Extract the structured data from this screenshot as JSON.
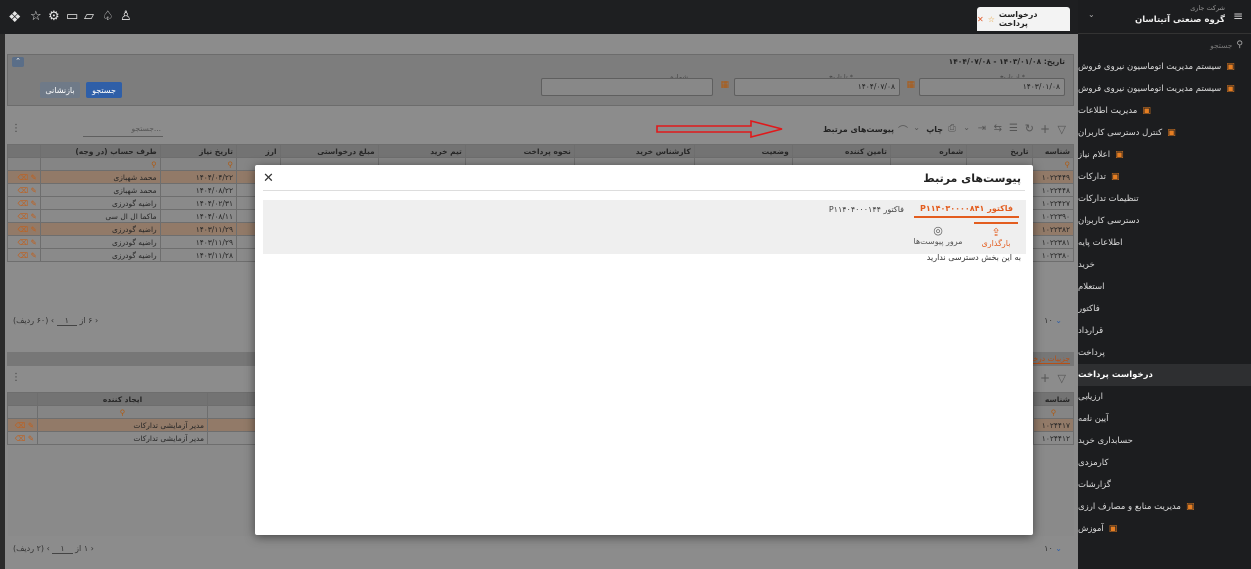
{
  "topbar": {
    "icons": [
      "app-logo-icon",
      "star-icon",
      "sitemap-icon",
      "chat-icon",
      "folder-icon",
      "bell-icon",
      "user-icon"
    ],
    "tab": {
      "label": "درخواست پرداخت"
    }
  },
  "sidebar": {
    "company_small": "شرکت جاری",
    "company": "گروه صنعتی آتیتاسان",
    "search_placeholder": "جستجو",
    "items": [
      {
        "label": "سیستم مدیریت اتوماسیون نیروی فروش",
        "level": 0
      },
      {
        "label": "سیستم مدیریت اتوماسیون نیروی فروش",
        "level": 0
      },
      {
        "label": "مدیریت اطلاعات",
        "level": 0
      },
      {
        "label": "کنترل دسترسی کاربران",
        "level": 0
      },
      {
        "label": "اعلام نیاز",
        "level": 0
      },
      {
        "label": "تدارکات",
        "level": 0
      },
      {
        "label": "تنظیمات تدارکات",
        "level": 1
      },
      {
        "label": "دسترسی کاربران",
        "level": 1
      },
      {
        "label": "اطلاعات پایه",
        "level": 1
      },
      {
        "label": "خرید",
        "level": 1
      },
      {
        "label": "استعلام",
        "level": 1
      },
      {
        "label": "فاکتور",
        "level": 1
      },
      {
        "label": "قرارداد",
        "level": 1
      },
      {
        "label": "پرداخت",
        "level": 1
      },
      {
        "label": "درخواست پرداخت",
        "level": 2
      },
      {
        "label": "ارزیابی",
        "level": 1
      },
      {
        "label": "آیین نامه",
        "level": 1
      },
      {
        "label": "حسابداری خرید",
        "level": 1
      },
      {
        "label": "کارمزدی",
        "level": 1
      },
      {
        "label": "گزارشات",
        "level": 1
      },
      {
        "label": "مدیریت منابع و مصارف ارزی",
        "level": 0
      },
      {
        "label": "آموزش",
        "level": 0
      }
    ]
  },
  "filter": {
    "date_label": "تاریخ: ۱۴۰۳/۰۱/۰۸ - ۱۴۰۴/۰۷/۰۸",
    "from_label": "از تاریخ *",
    "from_value": "۱۴۰۳/۰۱/۰۸",
    "to_label": "تا تاریخ *",
    "to_value": "۱۴۰۴/۰۷/۰۸",
    "number_label": "شماره",
    "search_button": "جستجو",
    "reset_button": "بازنشانی"
  },
  "toolbar": {
    "attachments": "پیوست‌های مرتبط",
    "print": "چاپ",
    "search_placeholder": "جستجو..."
  },
  "grid": {
    "headers": [
      "شناسه",
      "تاریخ",
      "شماره",
      "تامین کننده",
      "وضعیت",
      "کارشناس خرید",
      "نحوه پرداخت",
      "تیم خرید",
      "مبلغ درخواستی",
      "ارز",
      "تاریخ نیاز",
      "طرف حساب (در وجه)"
    ],
    "ids": [
      "۱۰۲۲۴۴۹",
      "۱۰۲۲۴۴۸",
      "۱۰۲۲۴۲۷",
      "۱۰۲۲۳۹۰",
      "۱۰۲۲۳۸۲",
      "۱۰۲۲۳۸۱",
      "۱۰۲۲۳۸۰"
    ],
    "rows": [
      {
        "need_date": "۱۴۰۴/۰۴/۲۲",
        "party": "محمد شهبازی"
      },
      {
        "need_date": "۱۴۰۴/۰۸/۲۲",
        "party": "محمد شهبازی"
      },
      {
        "need_date": "۱۴۰۴/۰۲/۳۱",
        "party": "راضیه گودرزی"
      },
      {
        "need_date": "۱۴۰۴/۰۸/۱۱",
        "party": "ماکما ال ال سی"
      },
      {
        "need_date": "۱۴۰۳/۱۱/۲۹",
        "party": "راضیه گودرزی"
      },
      {
        "need_date": "۱۴۰۳/۱۱/۲۹",
        "party": "راضیه گودرزی"
      },
      {
        "need_date": "۱۴۰۳/۱۱/۲۸",
        "party": "راضیه گودرزی"
      }
    ],
    "footer": "(۶۰ ردیف)",
    "page": "۱",
    "of": "از",
    "pages": "۶",
    "page_size": "۱۰"
  },
  "details": {
    "tab": "جزییات درخوا",
    "headers": {
      "id": "شناسه",
      "creator": "ایجاد کننده"
    },
    "ids": [
      "۱۰۲۴۴۱۷",
      "۱۰۲۴۴۱۲"
    ],
    "creators": [
      "مدیر آزمایشی تدارکات",
      "مدیر آزمایشی تدارکات"
    ],
    "footer": "(۲ ردیف)",
    "page": "۱",
    "of": "از",
    "pages": "۱",
    "page_size": "۱۰"
  },
  "modal": {
    "title": "پیوست‌های مرتبط",
    "tab_active": "فاکتور P۱۱۴۰۳۰۰۰۰۸۴۱",
    "tab_other_prefix": "فاکتور",
    "tab_other": "P۱۱۴۰۴۰۰۰۱۴۴",
    "upload": "بارگذاری",
    "review": "مرور پیوست‌ها",
    "no_access": "به این بخش دسترسی ندارید"
  },
  "colors": {
    "accent": "#e35d1f",
    "primary_btn": "#2f5fa8",
    "arrow": "#e0191b"
  }
}
